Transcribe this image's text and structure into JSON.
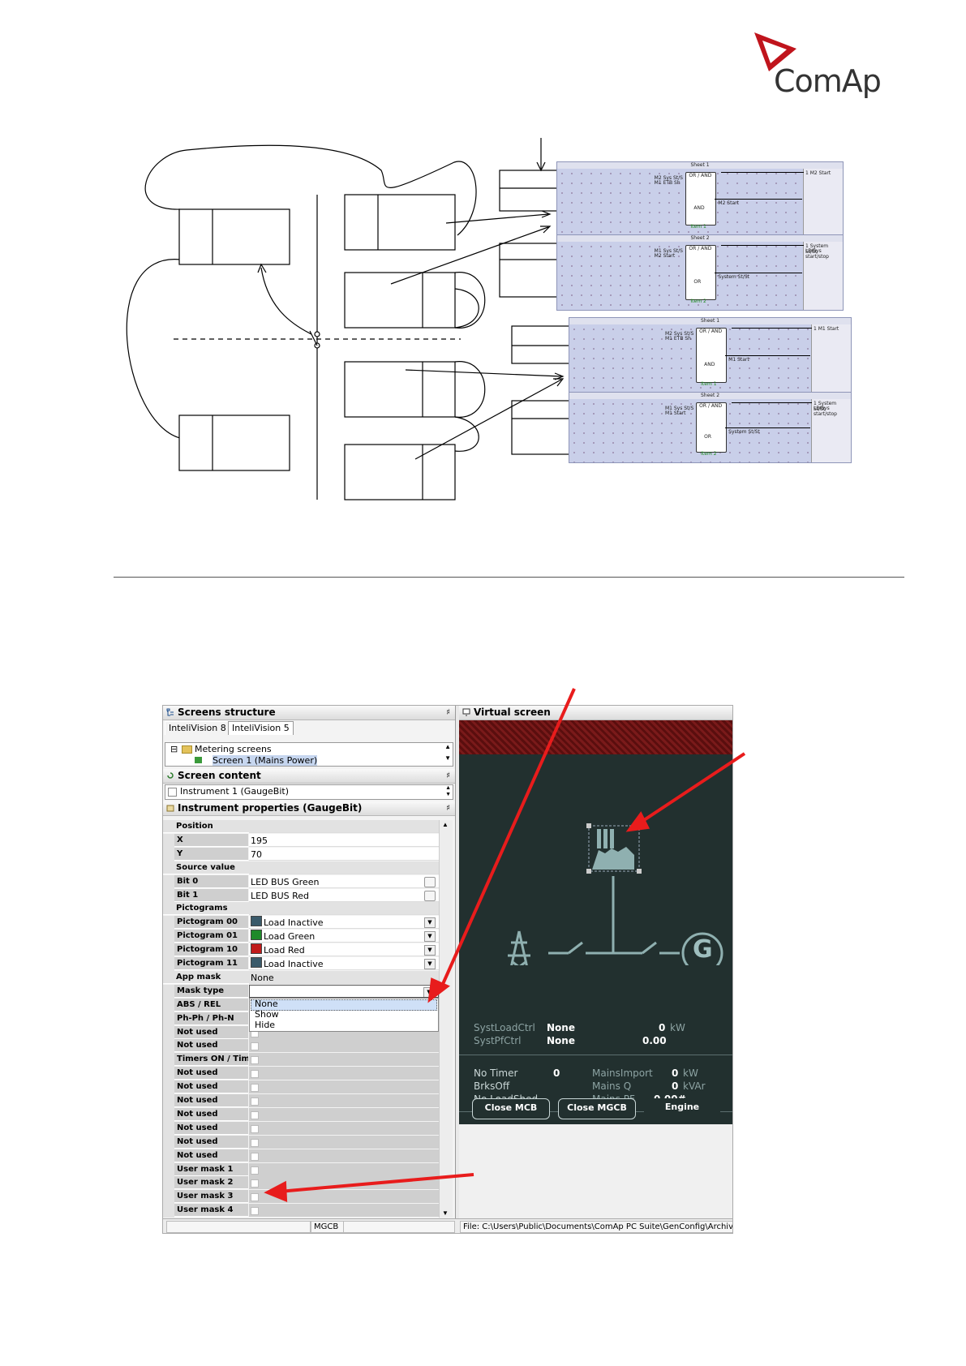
{
  "logo": {
    "text": "ComAp",
    "brand_color": "#c0141c"
  },
  "diagram": {
    "sheets": [
      {
        "title": "Sheet 1",
        "block_type": "OR / AND",
        "mode": "AND",
        "out_label": "M2 Start",
        "in1": "M2 Sys St/S",
        "in2": "M1 ETB Sh",
        "item": "Item 1",
        "output": "1 M2 Start",
        "output2": ""
      },
      {
        "title": "Sheet 2",
        "block_type": "OR / AND",
        "mode": "OR",
        "out_label": "System St/St",
        "in1": "M1 Sys St/S",
        "in2": "M2 Start",
        "item": "Item 2",
        "output": "1 System St/St",
        "output2": "LBISys start/stop"
      },
      {
        "title": "Sheet 1",
        "block_type": "OR / AND",
        "mode": "AND",
        "out_label": "M1 Start",
        "in1": "M2 Sys St/S",
        "in2": "M1 ETB Sh",
        "item": "Item 1",
        "output": "1 M1 Start",
        "output2": ""
      },
      {
        "title": "Sheet 2",
        "block_type": "OR / AND",
        "mode": "OR",
        "out_label": "System St/St",
        "in1": "M1 Sys St/S",
        "in2": "M1 Start",
        "item": "Item 2",
        "output": "1 System St/St",
        "output2": "LBISys start/stop"
      }
    ]
  },
  "screenshot": {
    "screens_structure": {
      "title": "Screens structure",
      "tabs": [
        "InteliVision 8",
        "InteliVision 5"
      ],
      "tree": [
        "Metering screens",
        "Screen 1 (Mains Power)"
      ]
    },
    "screen_content": {
      "title": "Screen content",
      "selected": "Instrument 1 (GaugeBit)"
    },
    "instrument_properties": {
      "title": "Instrument properties (GaugeBit)",
      "rows": [
        {
          "label": "Position",
          "value": "",
          "kind": "group"
        },
        {
          "label": "X",
          "value": "195",
          "kind": "scroll"
        },
        {
          "label": "Y",
          "value": "70",
          "kind": "text"
        },
        {
          "label": "Source value",
          "value": "",
          "kind": "group"
        },
        {
          "label": "Bit 0",
          "value": "LED BUS Green",
          "kind": "ellipsis"
        },
        {
          "label": "Bit 1",
          "value": "LED BUS Red",
          "kind": "ellipsis"
        },
        {
          "label": "Pictograms",
          "value": "",
          "kind": "group"
        },
        {
          "label": "Pictogram 00",
          "value": "Load Inactive",
          "kind": "picto",
          "color": "#3a5a6a"
        },
        {
          "label": "Pictogram 01",
          "value": "Load Green",
          "kind": "picto",
          "color": "#1f8a2a"
        },
        {
          "label": "Pictogram 10",
          "value": "Load Red",
          "kind": "picto",
          "color": "#c01a1a"
        },
        {
          "label": "Pictogram 11",
          "value": "Load Inactive",
          "kind": "picto",
          "color": "#3a5a6a"
        },
        {
          "label": "App mask",
          "value": "None",
          "kind": "group-val"
        },
        {
          "label": "Mask type",
          "value": "",
          "kind": "dropdown"
        },
        {
          "label": "ABS / REL",
          "value": "",
          "kind": "empty"
        },
        {
          "label": "Ph-Ph / Ph-N",
          "value": "",
          "kind": "empty"
        },
        {
          "label": "Not used",
          "value": "",
          "kind": "check"
        },
        {
          "label": "Not used",
          "value": "",
          "kind": "check"
        },
        {
          "label": "Timers ON / Timer",
          "value": "",
          "kind": "check"
        },
        {
          "label": "Not used",
          "value": "",
          "kind": "check"
        },
        {
          "label": "Not used",
          "value": "",
          "kind": "check"
        },
        {
          "label": "Not used",
          "value": "",
          "kind": "check"
        },
        {
          "label": "Not used",
          "value": "",
          "kind": "check"
        },
        {
          "label": "Not used",
          "value": "",
          "kind": "check"
        },
        {
          "label": "Not used",
          "value": "",
          "kind": "check"
        },
        {
          "label": "Not used",
          "value": "",
          "kind": "check"
        },
        {
          "label": "User mask 1",
          "value": "",
          "kind": "check"
        },
        {
          "label": "User mask 2",
          "value": "",
          "kind": "check"
        },
        {
          "label": "User mask 3",
          "value": "",
          "kind": "check"
        },
        {
          "label": "User mask 4",
          "value": "",
          "kind": "check"
        }
      ],
      "dropdown_options": [
        "None",
        "Show",
        "Hide"
      ]
    },
    "virtual_screen": {
      "title": "Virtual screen",
      "generator_label": "G",
      "line1": {
        "label": "SystLoadCtrl",
        "mode": "None",
        "value": "0",
        "unit": "kW"
      },
      "line2": {
        "label": "SystPfCtrl",
        "mode": "None",
        "value": "0.00",
        "unit": ""
      },
      "left_col": [
        {
          "label": "No Timer",
          "value": "0"
        },
        {
          "label": "BrksOff",
          "value": ""
        },
        {
          "label": "No LoadShed",
          "value": ""
        }
      ],
      "right_col": [
        {
          "label": "MainsImport",
          "value": "0",
          "unit": "kW"
        },
        {
          "label": "Mains Q",
          "value": "0",
          "unit": "kVAr"
        },
        {
          "label": "Mains PF",
          "value": "0.00#",
          "unit": ""
        }
      ],
      "buttons": [
        "Close MCB",
        "Close MGCB",
        "Engine"
      ]
    },
    "status_bar": {
      "mode": "MGCB",
      "file": "File: C:\\Users\\Public\\Documents\\ComAp PC Suite\\GenConfig\\Archives\\"
    },
    "accent_arrow_color": "#e81c1c"
  }
}
